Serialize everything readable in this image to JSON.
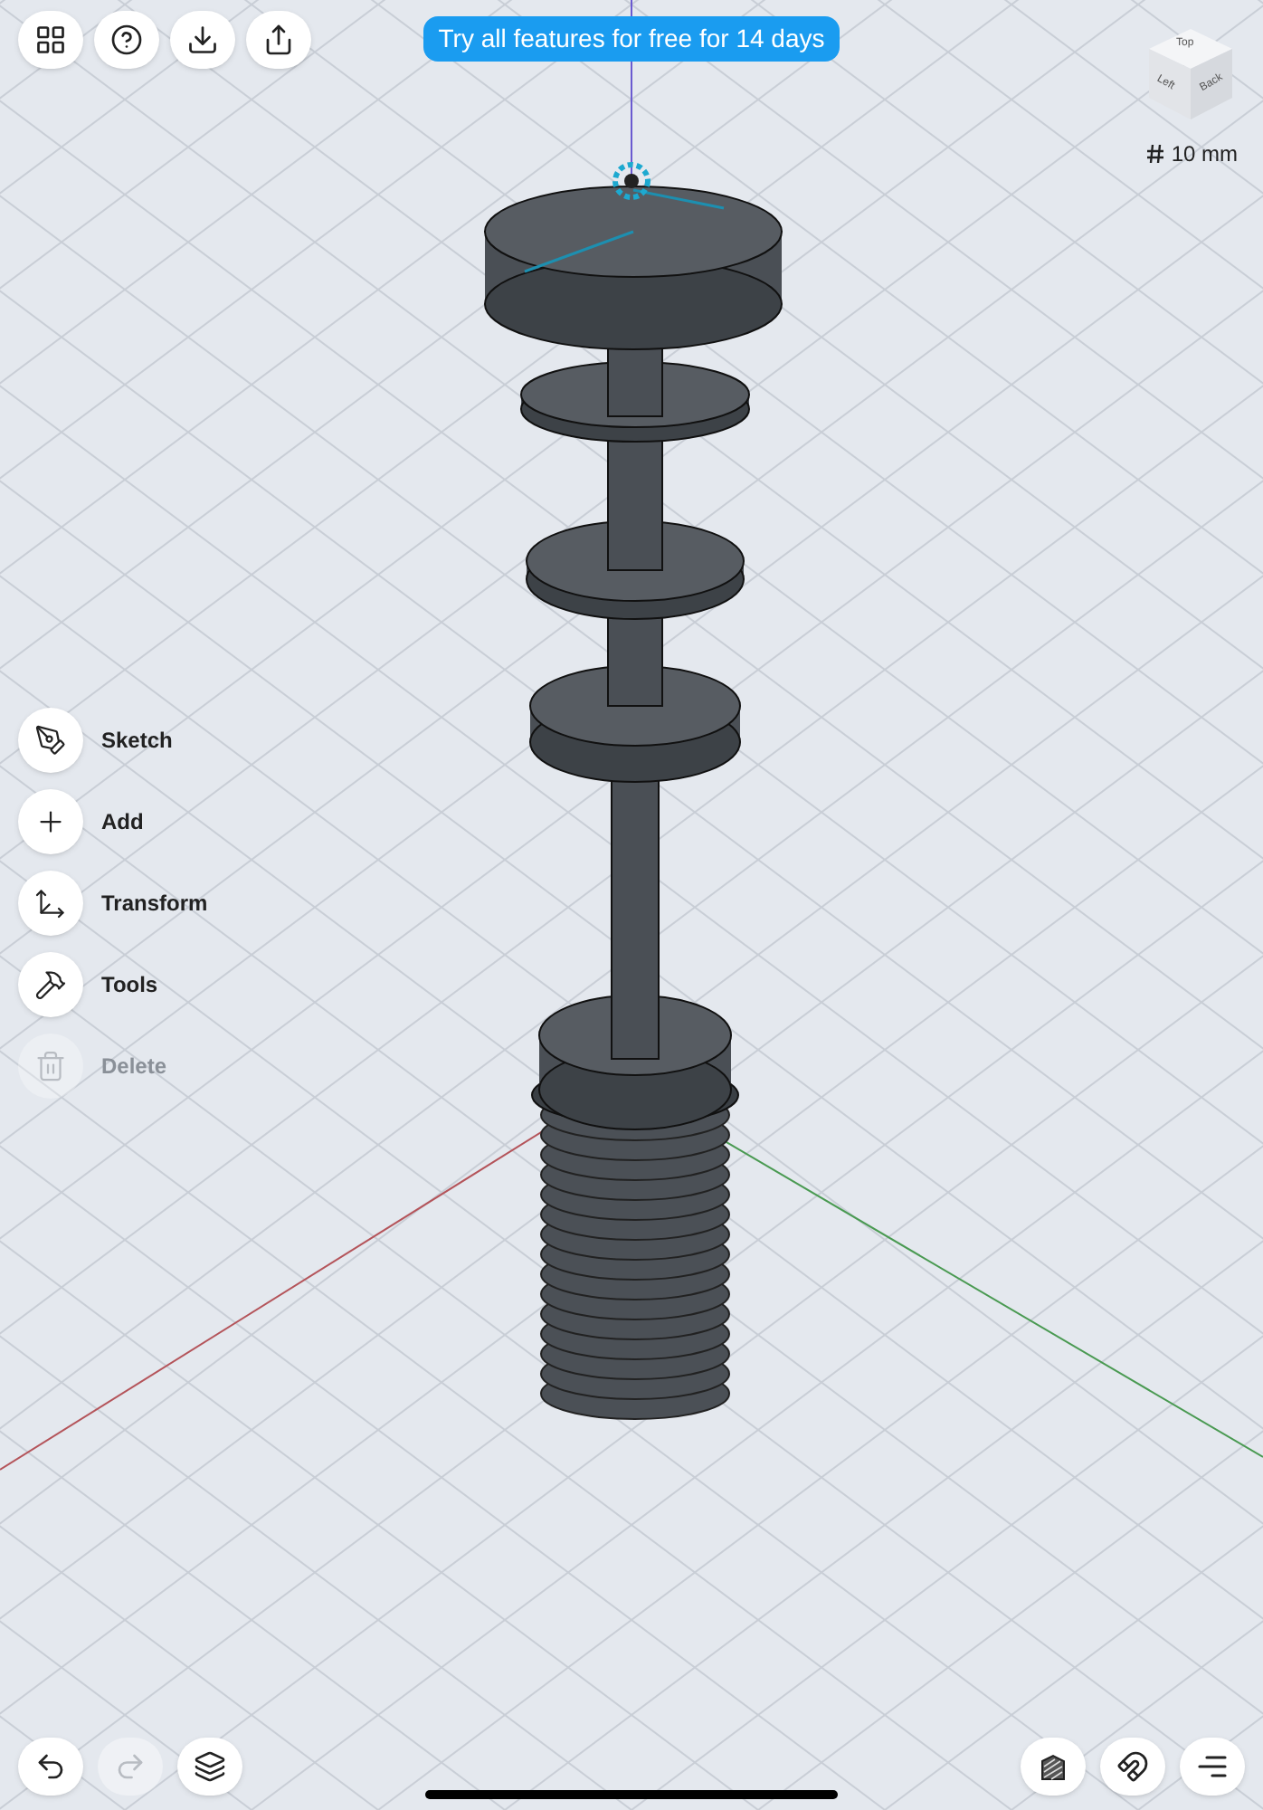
{
  "banner": "Try all features for free for 14 days",
  "view_cube": {
    "faces": [
      "Top",
      "Left",
      "Back"
    ]
  },
  "grid_scale": "10 mm",
  "menu": [
    {
      "kind": "sketch",
      "label": "Sketch",
      "disabled": false
    },
    {
      "kind": "add",
      "label": "Add",
      "disabled": false
    },
    {
      "kind": "transform",
      "label": "Transform",
      "disabled": false
    },
    {
      "kind": "tools",
      "label": "Tools",
      "disabled": false
    },
    {
      "kind": "delete",
      "label": "Delete",
      "disabled": true
    }
  ],
  "bottom_left": [
    {
      "kind": "undo",
      "disabled": false
    },
    {
      "kind": "redo",
      "disabled": true
    },
    {
      "kind": "layers",
      "disabled": false
    }
  ]
}
